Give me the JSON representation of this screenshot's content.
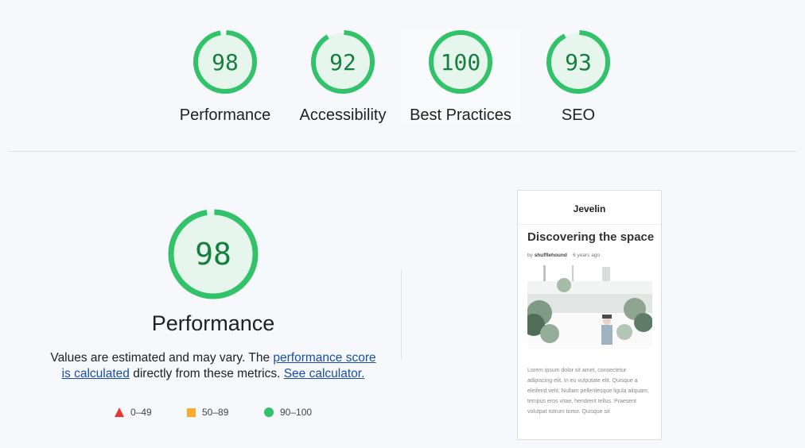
{
  "scores": [
    {
      "value": "98",
      "fraction": 0.98,
      "label": "Performance"
    },
    {
      "value": "92",
      "fraction": 0.92,
      "label": "Accessibility"
    },
    {
      "value": "100",
      "fraction": 1.0,
      "label": "Best Practices"
    },
    {
      "value": "93",
      "fraction": 0.93,
      "label": "SEO"
    }
  ],
  "main": {
    "value": "98",
    "fraction": 0.98,
    "title": "Performance",
    "desc_1": "Values are estimated and may vary. The ",
    "link_1": "performance score is calculated",
    "desc_2": " directly from these metrics. ",
    "link_2": "See calculator."
  },
  "legend": [
    {
      "shape": "triangle",
      "color": "#e53935",
      "range": "0–49"
    },
    {
      "shape": "square",
      "color": "#fbab2c",
      "range": "50–89"
    },
    {
      "shape": "circle",
      "color": "#31c26a",
      "range": "90–100"
    }
  ],
  "colors": {
    "pass_ring": "#31c26a",
    "pass_fill": "#e6f6ec",
    "pass_text": "#15803d"
  },
  "preview": {
    "brand": "Jevelin",
    "title": "Discovering the space",
    "meta_by": "by",
    "meta_author": "shufflehound",
    "meta_time": "6 years ago",
    "body": "Lorem ipsum dolor sit amet, consectetur adipiscing elit. In eu vulputate elit. Quisque a eleifend velit. Nullam pellentesque ligula aliquam, tempus eros vitae, hendrerit tellus. Praesent volutpat rutrum tortor. Quisque sit"
  }
}
